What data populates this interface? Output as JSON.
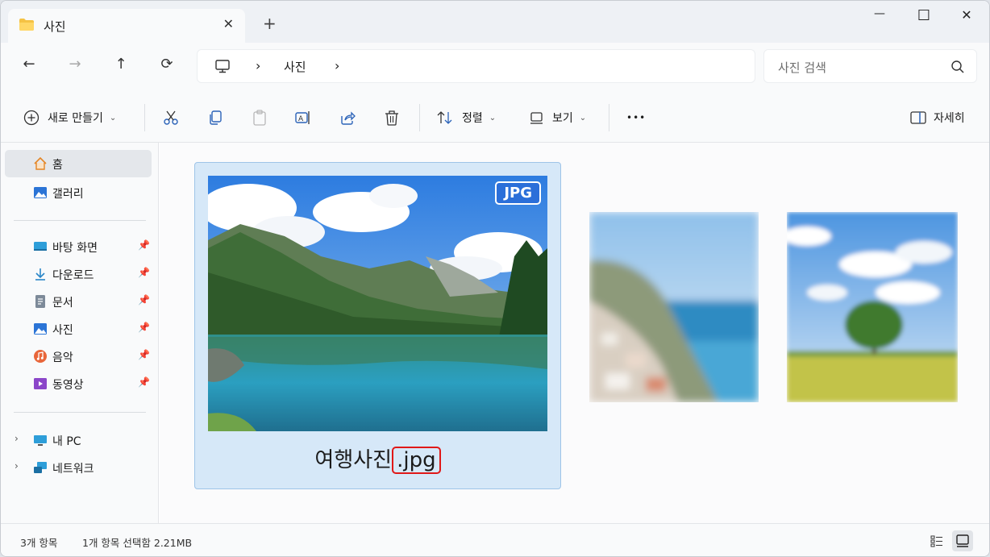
{
  "tab": {
    "title": "사진",
    "close": "✕"
  },
  "newtab": "+",
  "window": {
    "minimize": "—",
    "maximize": "☐",
    "close": "✕"
  },
  "nav": {
    "back": "←",
    "forward": "→",
    "up": "↑",
    "refresh": "⟳"
  },
  "address": {
    "sep1": "›",
    "crumb": "사진",
    "sep2": "›"
  },
  "search": {
    "placeholder": "사진 검색"
  },
  "toolbar": {
    "new_label": "새로 만들기",
    "sort_label": "정렬",
    "view_label": "보기",
    "more": "•••",
    "details_label": "자세히"
  },
  "sidebar": {
    "home": "홈",
    "gallery": "갤러리",
    "pinned": [
      {
        "label": "바탕 화면",
        "icon": "desktop-icon"
      },
      {
        "label": "다운로드",
        "icon": "download-icon"
      },
      {
        "label": "문서",
        "icon": "document-icon"
      },
      {
        "label": "사진",
        "icon": "pictures-icon"
      },
      {
        "label": "음악",
        "icon": "music-icon"
      },
      {
        "label": "동영상",
        "icon": "video-icon"
      }
    ],
    "this_pc": "내 PC",
    "network": "네트워크"
  },
  "files": [
    {
      "name_base": "여행사진",
      "name_ext": ".jpg",
      "badge": "JPG",
      "selected": true
    },
    {
      "name_base": "",
      "name_ext": "",
      "blurred": true
    },
    {
      "name_base": "",
      "name_ext": "",
      "blurred": true
    }
  ],
  "status": {
    "count": "3개 항목",
    "selection": "1개 항목 선택함 2.21MB"
  },
  "colors": {
    "accent": "#2b6fd9",
    "selection": "#d6e8f8",
    "highlight": "#e01818"
  }
}
